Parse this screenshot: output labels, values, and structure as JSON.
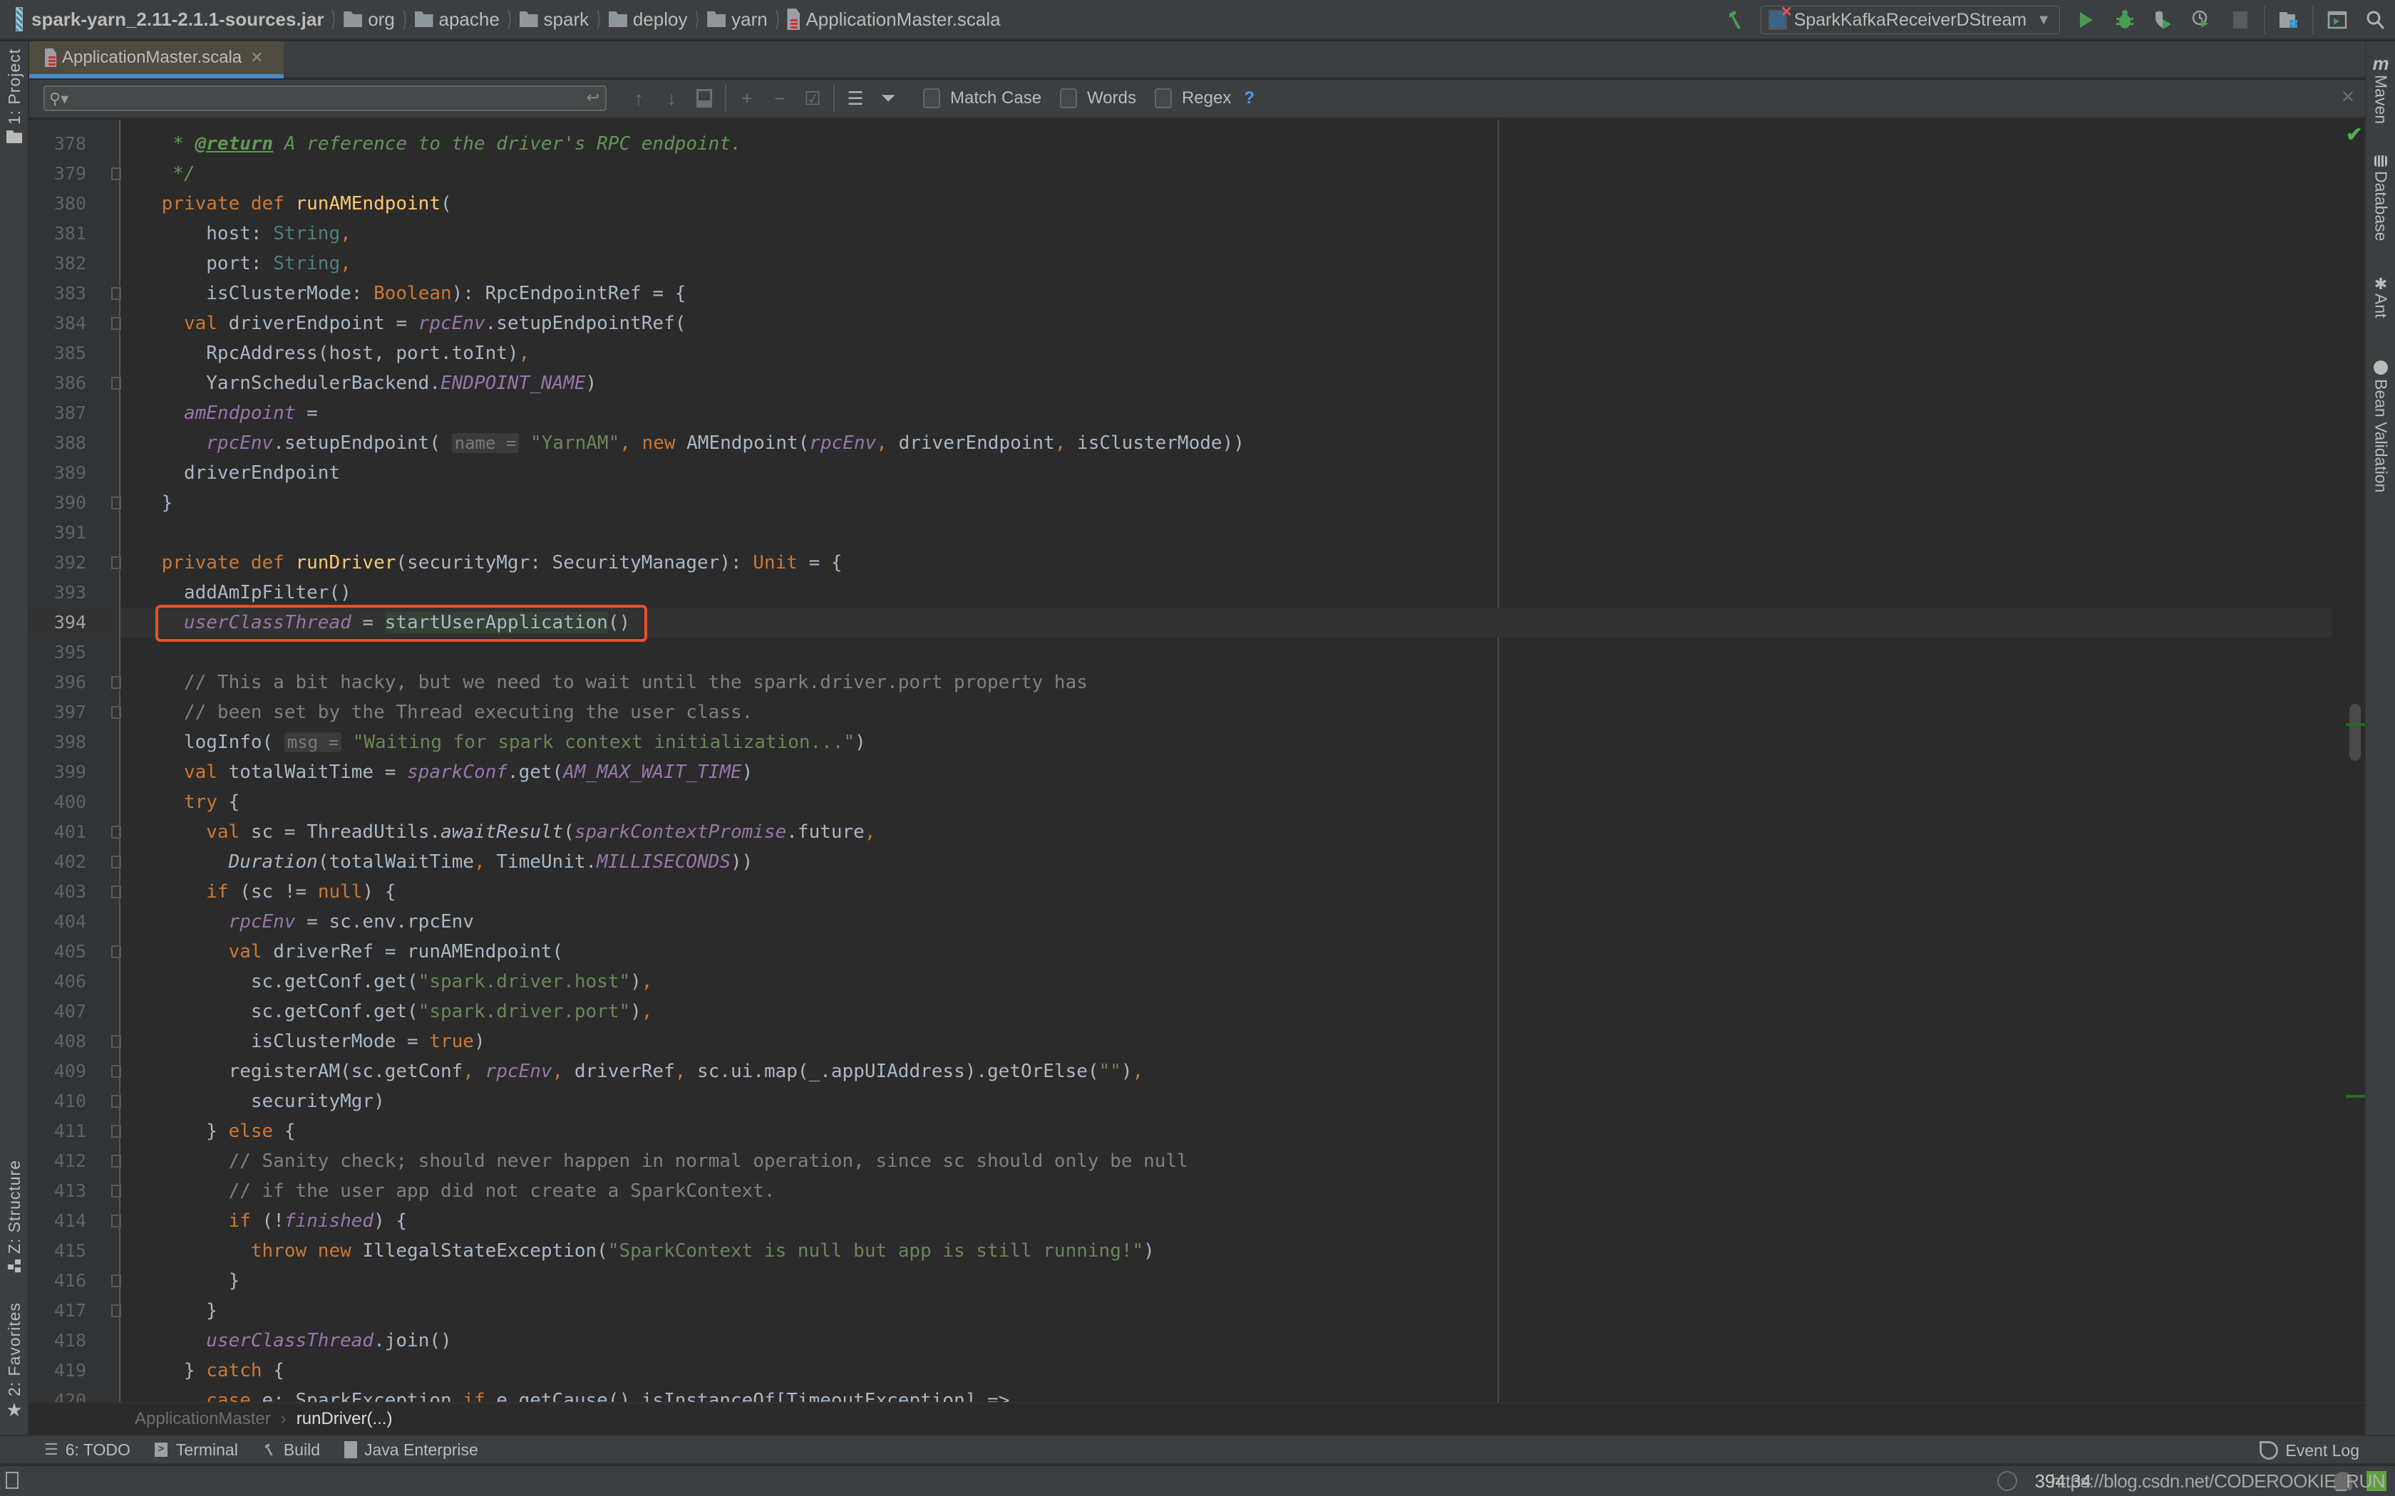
{
  "navbar": {
    "breadcrumbs": [
      {
        "label": "spark-yarn_2.11-2.1.1-sources.jar",
        "icon": "jar-icon"
      },
      {
        "label": "org",
        "icon": "folder-icon"
      },
      {
        "label": "apache",
        "icon": "folder-icon"
      },
      {
        "label": "spark",
        "icon": "folder-icon"
      },
      {
        "label": "deploy",
        "icon": "folder-icon"
      },
      {
        "label": "yarn",
        "icon": "folder-icon"
      },
      {
        "label": "ApplicationMaster.scala",
        "icon": "scala-file-icon"
      }
    ],
    "run_configuration": "SparkKafkaReceiverDStream",
    "toolbar_icons": [
      "build-hammer-icon",
      "run-icon",
      "debug-icon",
      "run-with-coverage-icon",
      "profile-icon",
      "stop-icon",
      "project-structure-icon",
      "run-anything-icon",
      "search-everywhere-icon"
    ]
  },
  "tabs": [
    {
      "label": "ApplicationMaster.scala",
      "active": true
    }
  ],
  "search": {
    "value": "",
    "placeholder": "",
    "options": [
      {
        "label": "Match Case",
        "checked": false
      },
      {
        "label": "Words",
        "checked": false
      },
      {
        "label": "Regex",
        "checked": false
      }
    ],
    "help": "?"
  },
  "left_tool_windows": [
    {
      "label": "1: Project",
      "icon": "folder-icon"
    },
    {
      "label": "Z: Structure",
      "icon": "structure-icon"
    },
    {
      "label": "2: Favorites",
      "icon": "star-icon"
    }
  ],
  "right_tool_windows": [
    {
      "label": "Maven",
      "icon": "maven-icon"
    },
    {
      "label": "Database",
      "icon": "database-icon"
    },
    {
      "label": "Ant",
      "icon": "ant-icon"
    },
    {
      "label": "Bean Validation",
      "icon": "bean-validation-icon"
    }
  ],
  "editor": {
    "current_line": 394,
    "highlighted_line": 394,
    "lines": [
      {
        "n": "378",
        "t": [
          [
            "doc",
            "  * "
          ],
          [
            "doctag",
            "@return"
          ],
          [
            "doc",
            " A reference to the driver's RPC endpoint."
          ]
        ]
      },
      {
        "n": "379",
        "t": [
          [
            "doc",
            "  */"
          ]
        ]
      },
      {
        "n": "380",
        "t": [
          [
            "kw",
            " private def "
          ],
          [
            "fn",
            "runAMEndpoint"
          ],
          [
            "",
            "("
          ]
        ]
      },
      {
        "n": "381",
        "t": [
          [
            "",
            "     host: "
          ],
          [
            "ty",
            "String"
          ],
          [
            "kw",
            ","
          ]
        ]
      },
      {
        "n": "382",
        "t": [
          [
            "",
            "     port: "
          ],
          [
            "ty",
            "String"
          ],
          [
            "kw",
            ","
          ]
        ]
      },
      {
        "n": "383",
        "t": [
          [
            "",
            "     isClusterMode: "
          ],
          [
            "kw",
            "Boolean"
          ],
          [
            "",
            "): RpcEndpointRef = {"
          ]
        ]
      },
      {
        "n": "384",
        "t": [
          [
            "kw",
            "   val "
          ],
          [
            "",
            "driverEndpoint = "
          ],
          [
            "field",
            "rpcEnv"
          ],
          [
            "",
            ".setupEndpointRef("
          ]
        ]
      },
      {
        "n": "385",
        "t": [
          [
            "",
            "     RpcAddress(host, port.toInt)"
          ],
          [
            "kw",
            ","
          ]
        ]
      },
      {
        "n": "386",
        "t": [
          [
            "",
            "     YarnSchedulerBackend."
          ],
          [
            "const",
            "ENDPOINT_NAME"
          ],
          [
            "",
            ")"
          ]
        ]
      },
      {
        "n": "387",
        "t": [
          [
            "field",
            "   amEndpoint"
          ],
          [
            "",
            " ="
          ]
        ]
      },
      {
        "n": "388",
        "t": [
          [
            "field",
            "     rpcEnv"
          ],
          [
            "",
            ".setupEndpoint( "
          ],
          [
            "hint",
            "name ="
          ],
          [
            "str",
            " \"YarnAM\""
          ],
          [
            "kw",
            ", new "
          ],
          [
            "",
            "AMEndpoint("
          ],
          [
            "field",
            "rpcEnv"
          ],
          [
            "kw",
            ", "
          ],
          [
            "",
            "driverEndpoint"
          ],
          [
            "kw",
            ", "
          ],
          [
            "",
            "isClusterMode))"
          ]
        ]
      },
      {
        "n": "389",
        "t": [
          [
            "",
            "   driverEndpoint"
          ]
        ]
      },
      {
        "n": "390",
        "t": [
          [
            "",
            " }"
          ]
        ]
      },
      {
        "n": "391",
        "t": [
          [
            "",
            ""
          ]
        ]
      },
      {
        "n": "392",
        "t": [
          [
            "kw",
            " private def "
          ],
          [
            "fn",
            "runDriver"
          ],
          [
            "",
            "(securityMgr: SecurityManager): "
          ],
          [
            "kw",
            "Unit"
          ],
          [
            "",
            " = {"
          ]
        ]
      },
      {
        "n": "393",
        "t": [
          [
            "",
            "   addAmIpFilter()"
          ]
        ]
      },
      {
        "n": "394",
        "t": [
          [
            "field",
            "   userClassThread"
          ],
          [
            "",
            " = "
          ],
          [
            "usage",
            "startUserApplication"
          ],
          [
            "",
            "()"
          ]
        ]
      },
      {
        "n": "395",
        "t": [
          [
            "",
            ""
          ]
        ]
      },
      {
        "n": "396",
        "t": [
          [
            "cm",
            "   // This a bit hacky, but we need to wait until the spark.driver.port property has"
          ]
        ]
      },
      {
        "n": "397",
        "t": [
          [
            "cm",
            "   // been set by the Thread executing the user class."
          ]
        ]
      },
      {
        "n": "398",
        "t": [
          [
            "",
            "   logInfo( "
          ],
          [
            "hint",
            "msg ="
          ],
          [
            "str",
            " \"Waiting for spark context initialization...\""
          ],
          [
            "",
            ")"
          ]
        ]
      },
      {
        "n": "399",
        "t": [
          [
            "kw",
            "   val "
          ],
          [
            "",
            "totalWaitTime = "
          ],
          [
            "field",
            "sparkConf"
          ],
          [
            "",
            ".get("
          ],
          [
            "const",
            "AM_MAX_WAIT_TIME"
          ],
          [
            "",
            ")"
          ]
        ]
      },
      {
        "n": "400",
        "t": [
          [
            "kw",
            "   try "
          ],
          [
            "",
            "{"
          ]
        ]
      },
      {
        "n": "401",
        "t": [
          [
            "kw",
            "     val "
          ],
          [
            "",
            "sc = ThreadUtils."
          ],
          [
            "it",
            "awaitResult"
          ],
          [
            "",
            "("
          ],
          [
            "field",
            "sparkContextPromise"
          ],
          [
            "",
            ".future"
          ],
          [
            "kw",
            ","
          ]
        ]
      },
      {
        "n": "402",
        "t": [
          [
            "it",
            "       Duration"
          ],
          [
            "",
            "(totalWaitTime"
          ],
          [
            "kw",
            ", "
          ],
          [
            "",
            "TimeUnit."
          ],
          [
            "const",
            "MILLISECONDS"
          ],
          [
            "",
            "))"
          ]
        ]
      },
      {
        "n": "403",
        "t": [
          [
            "kw",
            "     if "
          ],
          [
            "",
            "(sc != "
          ],
          [
            "kw",
            "null"
          ],
          [
            "",
            ") {"
          ]
        ]
      },
      {
        "n": "404",
        "t": [
          [
            "field",
            "       rpcEnv"
          ],
          [
            "",
            " = sc.env.rpcEnv"
          ]
        ]
      },
      {
        "n": "405",
        "t": [
          [
            "kw",
            "       val "
          ],
          [
            "",
            "driverRef = runAMEndpoint("
          ]
        ]
      },
      {
        "n": "406",
        "t": [
          [
            "",
            "         sc.getConf.get("
          ],
          [
            "str",
            "\"spark.driver.host\""
          ],
          [
            "",
            ")"
          ],
          [
            "kw",
            ","
          ]
        ]
      },
      {
        "n": "407",
        "t": [
          [
            "",
            "         sc.getConf.get("
          ],
          [
            "str",
            "\"spark.driver.port\""
          ],
          [
            "",
            ")"
          ],
          [
            "kw",
            ","
          ]
        ]
      },
      {
        "n": "408",
        "t": [
          [
            "",
            "         isClusterMode = "
          ],
          [
            "kw",
            "true"
          ],
          [
            "",
            ")"
          ]
        ]
      },
      {
        "n": "409",
        "t": [
          [
            "",
            "       registerAM(sc.getConf"
          ],
          [
            "kw",
            ", "
          ],
          [
            "field",
            "rpcEnv"
          ],
          [
            "kw",
            ", "
          ],
          [
            "",
            "driverRef"
          ],
          [
            "kw",
            ", "
          ],
          [
            "",
            "sc.ui.map(_.appUIAddress).getOrElse("
          ],
          [
            "str",
            "\"\""
          ],
          [
            "",
            ")"
          ],
          [
            "kw",
            ","
          ]
        ]
      },
      {
        "n": "410",
        "t": [
          [
            "",
            "         securityMgr)"
          ]
        ]
      },
      {
        "n": "411",
        "t": [
          [
            "",
            "     } "
          ],
          [
            "kw",
            "else "
          ],
          [
            "",
            "{"
          ]
        ]
      },
      {
        "n": "412",
        "t": [
          [
            "cm",
            "       // Sanity check; should never happen in normal operation, since sc should only be null"
          ]
        ]
      },
      {
        "n": "413",
        "t": [
          [
            "cm",
            "       // if the user app did not create a SparkContext."
          ]
        ]
      },
      {
        "n": "414",
        "t": [
          [
            "kw",
            "       if "
          ],
          [
            "",
            "(!"
          ],
          [
            "field",
            "finished"
          ],
          [
            "",
            ") {"
          ]
        ]
      },
      {
        "n": "415",
        "t": [
          [
            "kw",
            "         throw new "
          ],
          [
            "",
            "IllegalStateException("
          ],
          [
            "str",
            "\"SparkContext is null but app is still running!\""
          ],
          [
            "",
            ")"
          ]
        ]
      },
      {
        "n": "416",
        "t": [
          [
            "",
            "       }"
          ]
        ]
      },
      {
        "n": "417",
        "t": [
          [
            "",
            "     }"
          ]
        ]
      },
      {
        "n": "418",
        "t": [
          [
            "field",
            "     userClassThread"
          ],
          [
            "",
            ".join()"
          ]
        ]
      },
      {
        "n": "419",
        "t": [
          [
            "",
            "   } "
          ],
          [
            "kw",
            "catch "
          ],
          [
            "",
            "{"
          ]
        ]
      },
      {
        "n": "420",
        "t": [
          [
            "kw",
            "     case "
          ],
          [
            "",
            "e: SparkException "
          ],
          [
            "kw",
            "if "
          ],
          [
            "",
            "e.getCause().isInstanceOf[TimeoutException] =>"
          ]
        ]
      }
    ]
  },
  "code_breadcrumbs": [
    "ApplicationMaster",
    "runDriver(...)"
  ],
  "bottom_tool_windows": [
    {
      "label": "6: TODO",
      "icon": "todo-list-icon"
    },
    {
      "label": "Terminal",
      "icon": "terminal-icon"
    },
    {
      "label": "Build",
      "icon": "build-hammer-icon"
    },
    {
      "label": "Java Enterprise",
      "icon": "java-enterprise-icon"
    }
  ],
  "event_log": "Event Log",
  "status": {
    "caret_position": "394:34",
    "watermark": "https://blog.csdn.net/CODEROOKIE_RUN"
  }
}
